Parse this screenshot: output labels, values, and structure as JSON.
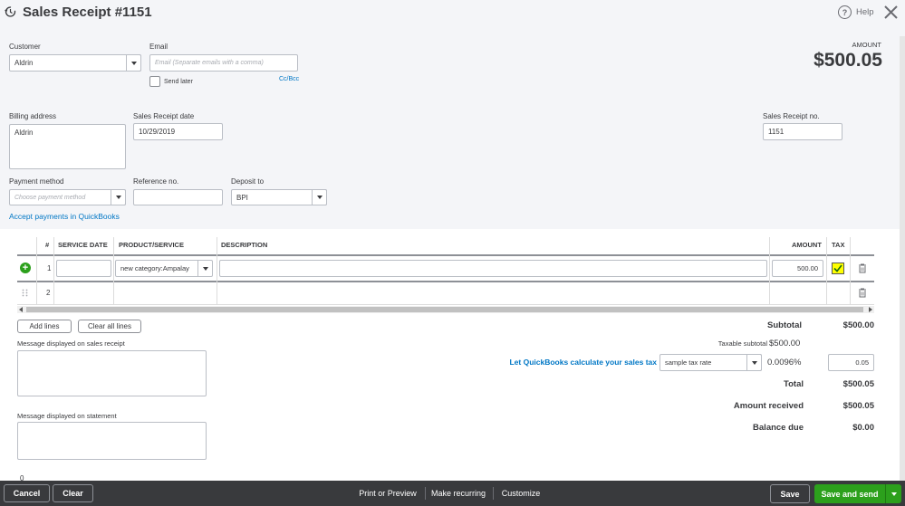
{
  "header": {
    "title": "Sales Receipt #1151",
    "help_label": "Help",
    "amount_label": "AMOUNT",
    "amount_value": "$500.05"
  },
  "customer": {
    "label": "Customer",
    "value": "Aldrin"
  },
  "email": {
    "label": "Email",
    "placeholder": "Email (Separate emails with a comma)",
    "send_later": "Send later",
    "cc_bcc": "Cc/Bcc"
  },
  "billing": {
    "label": "Billing address",
    "value": "Aldrin"
  },
  "receipt_date": {
    "label": "Sales Receipt date",
    "value": "10/29/2019"
  },
  "receipt_no": {
    "label": "Sales Receipt no.",
    "value": "1151"
  },
  "payment_method": {
    "label": "Payment method",
    "placeholder": "Choose payment method"
  },
  "reference": {
    "label": "Reference no.",
    "value": ""
  },
  "deposit_to": {
    "label": "Deposit to",
    "value": "BPI"
  },
  "accept_payments": "Accept payments in QuickBooks",
  "table": {
    "headers": {
      "num": "#",
      "service_date": "SERVICE DATE",
      "product": "PRODUCT/SERVICE",
      "description": "DESCRIPTION",
      "amount": "AMOUNT",
      "tax": "TAX"
    },
    "rows": [
      {
        "num": "1",
        "product": "new category:Ampalay",
        "amount": "500.00",
        "tax": true
      },
      {
        "num": "2"
      }
    ],
    "add_lines": "Add lines",
    "clear_lines": "Clear all lines"
  },
  "messages": {
    "receipt_label": "Message displayed on sales receipt",
    "statement_label": "Message displayed on statement"
  },
  "totals": {
    "subtotal_label": "Subtotal",
    "subtotal_value": "$500.00",
    "taxable_label": "Taxable subtotal",
    "taxable_value": "$500.00",
    "sales_tax_link": "Let QuickBooks calculate your sales tax",
    "tax_rate": "sample tax rate",
    "tax_percent": "0.0096%",
    "tax_amount": "0.05",
    "total_label": "Total",
    "total_value": "$500.05",
    "received_label": "Amount received",
    "received_value": "$500.05",
    "balance_label": "Balance due",
    "balance_value": "$0.00"
  },
  "footer": {
    "cancel": "Cancel",
    "clear": "Clear",
    "print": "Print or Preview",
    "recurring": "Make recurring",
    "customize": "Customize",
    "save": "Save",
    "save_send": "Save and send"
  },
  "colors": {
    "accent_green": "#2ca01c",
    "link_blue": "#0077c5",
    "footer_bg": "#393a3d",
    "check_highlight": "#ffff00"
  }
}
